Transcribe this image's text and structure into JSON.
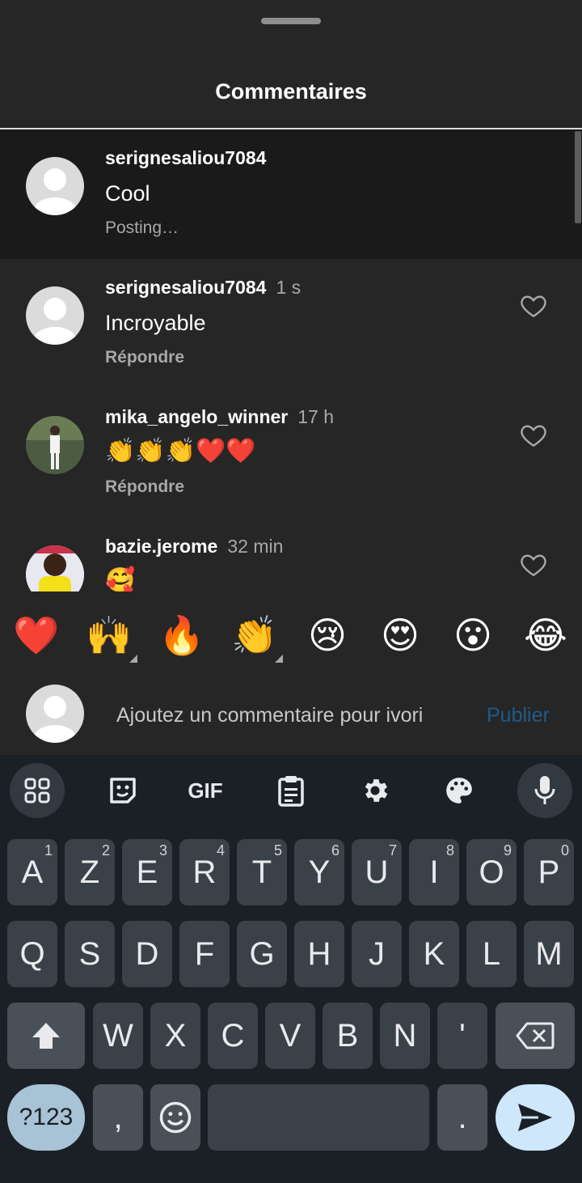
{
  "sheet": {
    "title": "Commentaires"
  },
  "comments": [
    {
      "username": "serignesaliou7084",
      "time": "",
      "text": "Cool",
      "sub": "Posting…",
      "state": "posting"
    },
    {
      "username": "serignesaliou7084",
      "time": "1 s",
      "text": "Incroyable",
      "sub": "Répondre"
    },
    {
      "username": "mika_angelo_winner",
      "time": "17 h",
      "text": "👏👏👏❤️❤️",
      "sub": "Répondre"
    },
    {
      "username": "bazie.jerome",
      "time": "32 min",
      "text": "🥰",
      "sub": ""
    }
  ],
  "quick_emojis": [
    "❤️",
    "🙌",
    "🔥",
    "👏",
    "😢",
    "😍",
    "😮",
    "😂"
  ],
  "composer": {
    "placeholder": "Ajoutez un commentaire pour ivori",
    "publish_label": "Publier"
  },
  "keyboard": {
    "toolbar": [
      "apps-grid-icon",
      "sticker-icon",
      "gif",
      "clipboard-icon",
      "settings-icon",
      "palette-icon",
      "mic-icon"
    ],
    "gif_label": "GIF",
    "row1": [
      {
        "k": "A",
        "h": "1"
      },
      {
        "k": "Z",
        "h": "2"
      },
      {
        "k": "E",
        "h": "3"
      },
      {
        "k": "R",
        "h": "4"
      },
      {
        "k": "T",
        "h": "5"
      },
      {
        "k": "Y",
        "h": "6"
      },
      {
        "k": "U",
        "h": "7"
      },
      {
        "k": "I",
        "h": "8"
      },
      {
        "k": "O",
        "h": "9"
      },
      {
        "k": "P",
        "h": "0"
      }
    ],
    "row2": [
      "Q",
      "S",
      "D",
      "F",
      "G",
      "H",
      "J",
      "K",
      "L",
      "M"
    ],
    "row3": [
      "W",
      "X",
      "C",
      "V",
      "B",
      "N",
      "'"
    ],
    "symbols_label": "?123",
    "comma": ",",
    "period": "."
  },
  "colors": {
    "background": "#262626",
    "keyboard_bg": "#1b2026",
    "publish": "#1f5a8a",
    "send_key": "#cfe7fb"
  }
}
